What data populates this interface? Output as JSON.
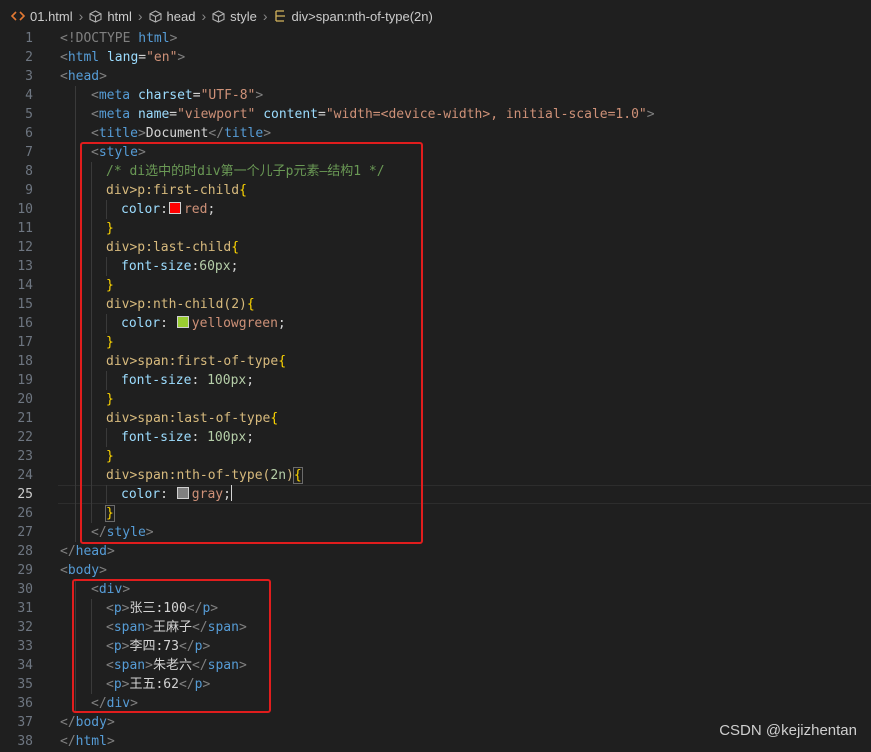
{
  "breadcrumb": {
    "items": [
      {
        "icon": "html-file-icon",
        "label": "01.html"
      },
      {
        "icon": "cube-icon",
        "label": "html"
      },
      {
        "icon": "cube-icon",
        "label": "head"
      },
      {
        "icon": "cube-icon",
        "label": "style"
      },
      {
        "icon": "css-selector-icon",
        "label": "div>span:nth-of-type(2n)"
      }
    ]
  },
  "editor": {
    "current_line": 25,
    "line_numbers": [
      "1",
      "2",
      "3",
      "4",
      "5",
      "6",
      "7",
      "8",
      "9",
      "10",
      "11",
      "12",
      "13",
      "14",
      "15",
      "16",
      "17",
      "18",
      "19",
      "20",
      "21",
      "22",
      "23",
      "24",
      "25",
      "26",
      "27",
      "28",
      "29",
      "30",
      "31",
      "32",
      "33",
      "34",
      "35",
      "36",
      "37",
      "38"
    ],
    "code": {
      "l1": {
        "open": "<!DOCTYPE ",
        "html": "html",
        "close": ">"
      },
      "l2": {
        "tag": "html",
        "attr": "lang",
        "eq": "=",
        "val": "\"en\""
      },
      "l3": {
        "tag": "head"
      },
      "l4": {
        "tag": "meta",
        "attr": "charset",
        "eq": "=",
        "val": "\"UTF-8\""
      },
      "l5": {
        "tag": "meta",
        "attr1": "name",
        "val1": "\"viewport\"",
        "attr2": "content",
        "val2": "\"width=<device-width>, initial-scale=1.0\""
      },
      "l6": {
        "tag": "title",
        "text": "Document"
      },
      "l7": {
        "tag": "style"
      },
      "l8": {
        "comment": "/* di选中的时div第一个儿子p元素—结构1 */"
      },
      "l9": {
        "selector": "div>p:first-child",
        "brace": "{"
      },
      "l10": {
        "prop": "color",
        "colon": ":",
        "value": "red",
        "semi": ";"
      },
      "l11": {
        "brace": "}"
      },
      "l12": {
        "selector": "div>p:last-child",
        "brace": "{"
      },
      "l13": {
        "prop": "font-size",
        "colon": ":",
        "value": "60px",
        "semi": ";"
      },
      "l14": {
        "brace": "}"
      },
      "l15": {
        "selector": "div>p:nth-child(2)",
        "brace": "{"
      },
      "l16": {
        "prop": "color",
        "colon": ": ",
        "value": "yellowgreen",
        "semi": ";"
      },
      "l17": {
        "brace": "}"
      },
      "l18": {
        "selector": "div>span:first-of-type",
        "brace": "{"
      },
      "l19": {
        "prop": "font-size",
        "colon": ": ",
        "value": "100px",
        "semi": ";"
      },
      "l20": {
        "brace": "}"
      },
      "l21": {
        "selector": "div>span:last-of-type",
        "brace": "{"
      },
      "l22": {
        "prop": "font-size",
        "colon": ": ",
        "value": "100px",
        "semi": ";"
      },
      "l23": {
        "brace": "}"
      },
      "l24": {
        "selector_a": "div>span:nth-of-type(",
        "selector_num": "2n",
        "selector_b": ")",
        "brace": "{"
      },
      "l25": {
        "prop": "color",
        "colon": ": ",
        "value": "gray",
        "semi": ";"
      },
      "l26": {
        "brace": "}"
      },
      "l27": {
        "tag": "style"
      },
      "l28": {
        "tag": "head"
      },
      "l29": {
        "tag": "body"
      },
      "l30": {
        "tag": "div"
      },
      "l31": {
        "tag": "p",
        "text": "张三:100"
      },
      "l32": {
        "tag": "span",
        "text": "王麻子"
      },
      "l33": {
        "tag": "p",
        "text": "李四:73"
      },
      "l34": {
        "tag": "span",
        "text": "朱老六"
      },
      "l35": {
        "tag": "p",
        "text": "王五:62"
      },
      "l36": {
        "tag": "div"
      },
      "l37": {
        "tag": "body"
      },
      "l38": {
        "tag": "html"
      }
    },
    "swatches": {
      "red": "#ff0000",
      "yellowgreen": "#9acd32",
      "gray": "#808080"
    }
  },
  "watermark": "CSDN @kejizhentan"
}
